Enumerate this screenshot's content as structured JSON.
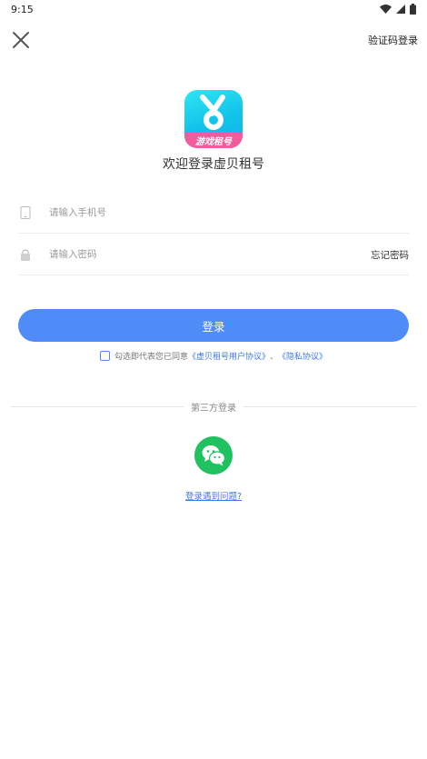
{
  "status_bar": {
    "time": "9:15",
    "icons": [
      "wifi-icon",
      "signal-icon",
      "battery-icon"
    ]
  },
  "header": {
    "close_icon": "close-icon",
    "sms_login_label": "验证码登录"
  },
  "logo": {
    "text": "游戏租号"
  },
  "welcome_text": "欢迎登录虚贝租号",
  "form": {
    "phone": {
      "placeholder": "请输入手机号",
      "value": "",
      "icon": "phone-icon"
    },
    "password": {
      "placeholder": "请输入密码",
      "value": "",
      "icon": "lock-icon"
    },
    "forgot_label": "忘记密码"
  },
  "login_button_label": "登录",
  "agreement": {
    "prefix": "勾选即代表您已同意",
    "user_agreement": "《虚贝租号用户协议》",
    "separator": "、",
    "privacy_policy": "《隐私协议》",
    "checked": false
  },
  "third_party": {
    "title": "第三方登录",
    "wechat_icon": "wechat-icon"
  },
  "help_link": "登录遇到问题?",
  "colors": {
    "primary": "#4f8cf8",
    "link": "#3b78e7",
    "wechat": "#1fc160",
    "logo_cyan": "#12c2ea",
    "logo_pink": "#f25c9c"
  }
}
